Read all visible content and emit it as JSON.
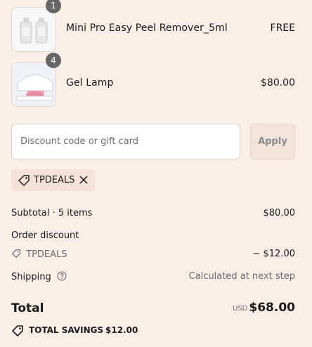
{
  "line_items": [
    {
      "quantity": "1",
      "name": "Mini Pro Easy Peel Remover_5ml",
      "price": "FREE"
    },
    {
      "quantity": "4",
      "name": "Gel Lamp",
      "price": "$80.00"
    }
  ],
  "discount": {
    "placeholder": "Discount code or gift card",
    "apply_label": "Apply",
    "applied_code": "TPDEALS"
  },
  "summary": {
    "subtotal_label": "Subtotal · 5 items",
    "subtotal_value": "$80.00",
    "order_discount_label": "Order discount",
    "discount_code": "TPDEALS",
    "discount_value": "− $12.00",
    "shipping_label": "Shipping",
    "shipping_value": "Calculated at next step",
    "total_label": "Total",
    "currency": "USD",
    "total_value": "$68.00",
    "savings_label": "TOTAL SAVINGS",
    "savings_value": "$12.00"
  },
  "colors": {
    "background": "#faeee6",
    "badge": "#666666",
    "chip": "#f4e2d7",
    "apply_button": "#f3e4da"
  }
}
